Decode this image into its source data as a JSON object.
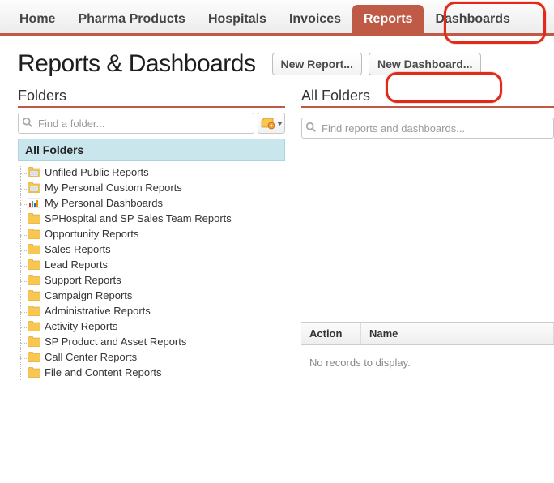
{
  "nav": {
    "items": [
      {
        "label": "Home"
      },
      {
        "label": "Pharma Products"
      },
      {
        "label": "Hospitals"
      },
      {
        "label": "Invoices"
      },
      {
        "label": "Reports",
        "active": true
      },
      {
        "label": "Dashboards"
      }
    ]
  },
  "header": {
    "page_title": "Reports & Dashboards",
    "new_report": "New Report...",
    "new_dashboard": "New Dashboard..."
  },
  "folders_panel": {
    "title": "Folders",
    "search_placeholder": "Find a folder...",
    "all_folders": "All Folders",
    "items": [
      {
        "label": "Unfiled Public Reports",
        "icon": "report"
      },
      {
        "label": "My Personal Custom Reports",
        "icon": "report"
      },
      {
        "label": "My Personal Dashboards",
        "icon": "dashboard"
      },
      {
        "label": "SPHospital and SP Sales Team Reports",
        "icon": "folder"
      },
      {
        "label": "Opportunity Reports",
        "icon": "folder"
      },
      {
        "label": "Sales Reports",
        "icon": "folder"
      },
      {
        "label": "Lead Reports",
        "icon": "folder"
      },
      {
        "label": "Support Reports",
        "icon": "folder"
      },
      {
        "label": "Campaign Reports",
        "icon": "folder"
      },
      {
        "label": "Administrative Reports",
        "icon": "folder"
      },
      {
        "label": "Activity Reports",
        "icon": "folder"
      },
      {
        "label": "SP Product and Asset Reports",
        "icon": "folder"
      },
      {
        "label": "Call Center Reports",
        "icon": "folder"
      },
      {
        "label": "File and Content Reports",
        "icon": "folder"
      }
    ]
  },
  "main_panel": {
    "title": "All Folders",
    "search_placeholder": "Find reports and dashboards...",
    "columns": {
      "action": "Action",
      "name": "Name"
    },
    "empty": "No records to display."
  }
}
